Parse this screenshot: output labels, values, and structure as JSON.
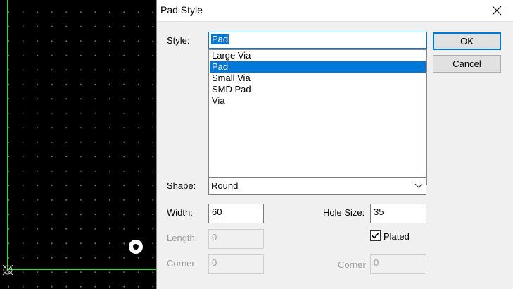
{
  "dialog": {
    "title": "Pad Style",
    "close_icon": "close-icon",
    "style_label": "Style:",
    "style_value": "Pad",
    "style_options": [
      "Large Via",
      "Pad",
      "Small Via",
      "SMD Pad",
      "Via"
    ],
    "selected_index": 1,
    "ok_label": "OK",
    "cancel_label": "Cancel",
    "shape_label": "Shape:",
    "shape_value": "Round",
    "width_label": "Width:",
    "width_value": "60",
    "length_label": "Length:",
    "length_value": "0",
    "corner_label": "Corner",
    "corner_value": "0",
    "hole_size_label": "Hole Size:",
    "hole_size_value": "35",
    "plated_label": "Plated",
    "plated_checked": true,
    "corner2_label": "Corner",
    "corner2_value": "0"
  },
  "colors": {
    "accent": "#0078d7",
    "board_edge": "#39d63f",
    "canvas_bg": "#000000",
    "grid_dot": "#6a6a6a"
  }
}
